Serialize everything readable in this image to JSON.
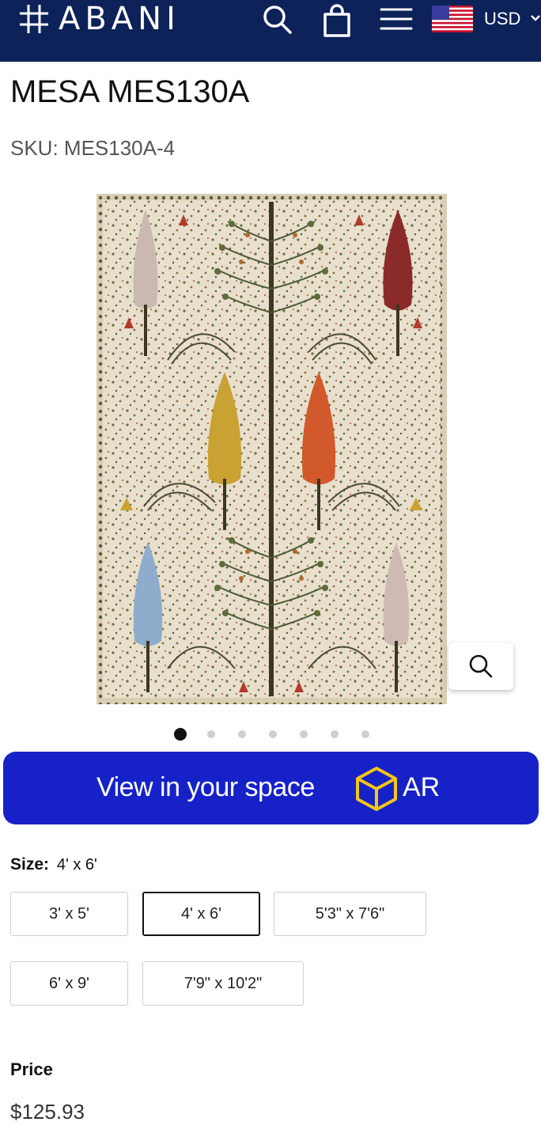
{
  "header": {
    "brand": "ABANI",
    "logo_icon": "hashtag-logo-icon",
    "search_icon": "search-icon",
    "cart_icon": "shopping-bag-icon",
    "menu_icon": "hamburger-menu-icon",
    "flag_icon": "us-flag-icon",
    "currency": "USD",
    "background": "#0c2258"
  },
  "product": {
    "title": "MESA MES130A",
    "sku": "SKU: MES130A-4"
  },
  "gallery": {
    "image_count": 7,
    "active_index": 0,
    "zoom_icon": "zoom-search-icon"
  },
  "ar_button": {
    "label": "View in your space",
    "badge": "AR",
    "icon": "ar-cube-icon",
    "color": "#1622c8",
    "icon_color": "#f5c518"
  },
  "size": {
    "label": "Size:",
    "selected": "4' x 6'",
    "options": [
      "3' x 5'",
      "4' x 6'",
      "5'3\" x 7'6\"",
      "6' x 9'",
      "7'9\" x 10'2\""
    ]
  },
  "price": {
    "label": "Price",
    "value": "$125.93"
  }
}
